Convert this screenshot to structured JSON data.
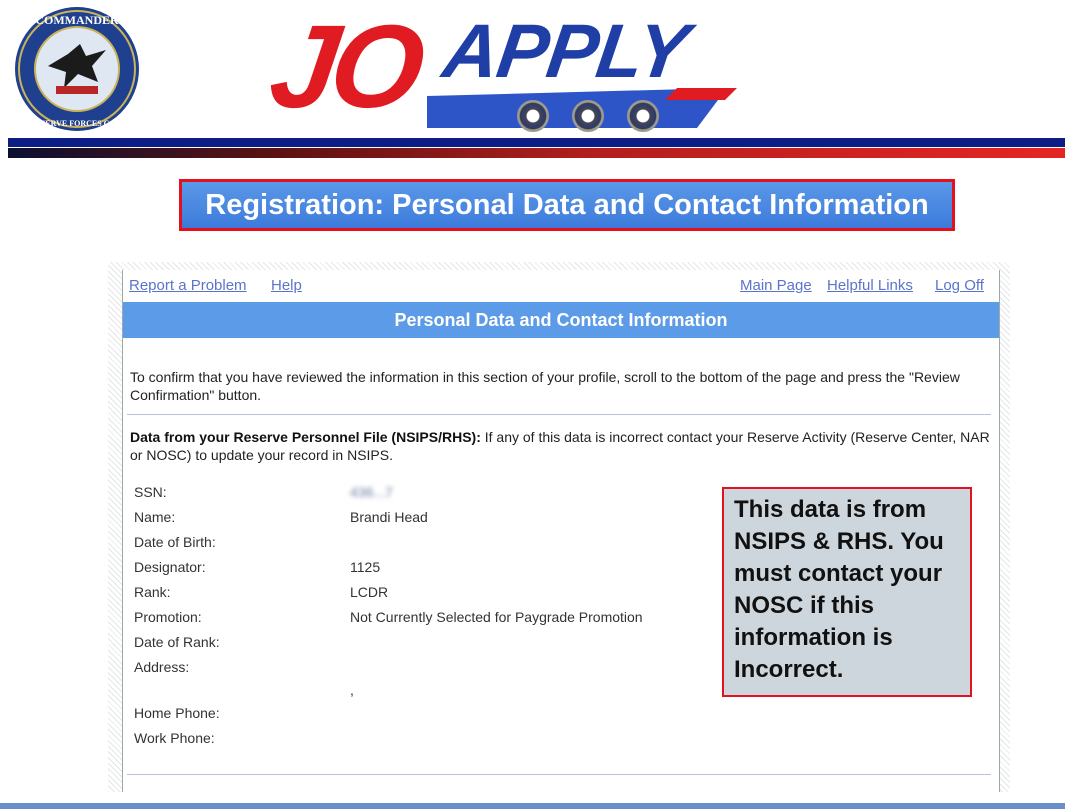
{
  "header": {
    "seal_text_top": "COMMANDER",
    "seal_text_bottom": "NAVY RESERVE FORCES COMMAND",
    "logo_text_1": "JO",
    "logo_text_2": "APPLY"
  },
  "title_banner": "Registration:  Personal Data and Contact Information",
  "top_links": {
    "left": [
      "Report a Problem",
      "Help"
    ],
    "right": [
      "Main Page",
      "Helpful Links",
      "Log Off"
    ]
  },
  "section_title": "Personal Data and Contact Information",
  "intro_text": "To confirm that you have reviewed the information in this section of your profile, scroll to the bottom of the page and press the \"Review Confirmation\" button.",
  "nsips_heading": "Data from your Reserve Personnel File (NSIPS/RHS):",
  "nsips_text": " If any of this data is incorrect contact your Reserve Activity (Reserve Center, NAR or NOSC) to update your record in NSIPS.",
  "fields": [
    {
      "label": "SSN:",
      "value": "436...7"
    },
    {
      "label": "Name:",
      "value": "Brandi Head"
    },
    {
      "label": "Date of Birth:",
      "value": ""
    },
    {
      "label": "Designator:",
      "value": "1125"
    },
    {
      "label": "Rank:",
      "value": "LCDR"
    },
    {
      "label": "Promotion:",
      "value": "Not Currently Selected for Paygrade Promotion"
    },
    {
      "label": "Date of Rank:",
      "value": ""
    },
    {
      "label": "Address:",
      "value": ""
    },
    {
      "label": "",
      "value": ","
    },
    {
      "label": "Home Phone:",
      "value": ""
    },
    {
      "label": "Work Phone:",
      "value": ""
    }
  ],
  "callout": "This data is from NSIPS & RHS. You must contact your NOSC if this information is Incorrect.",
  "colors": {
    "banner_blue": "#3d7bdc",
    "section_bar": "#5b9be8",
    "callout_border": "#e3101d",
    "link": "#5b74c9"
  }
}
